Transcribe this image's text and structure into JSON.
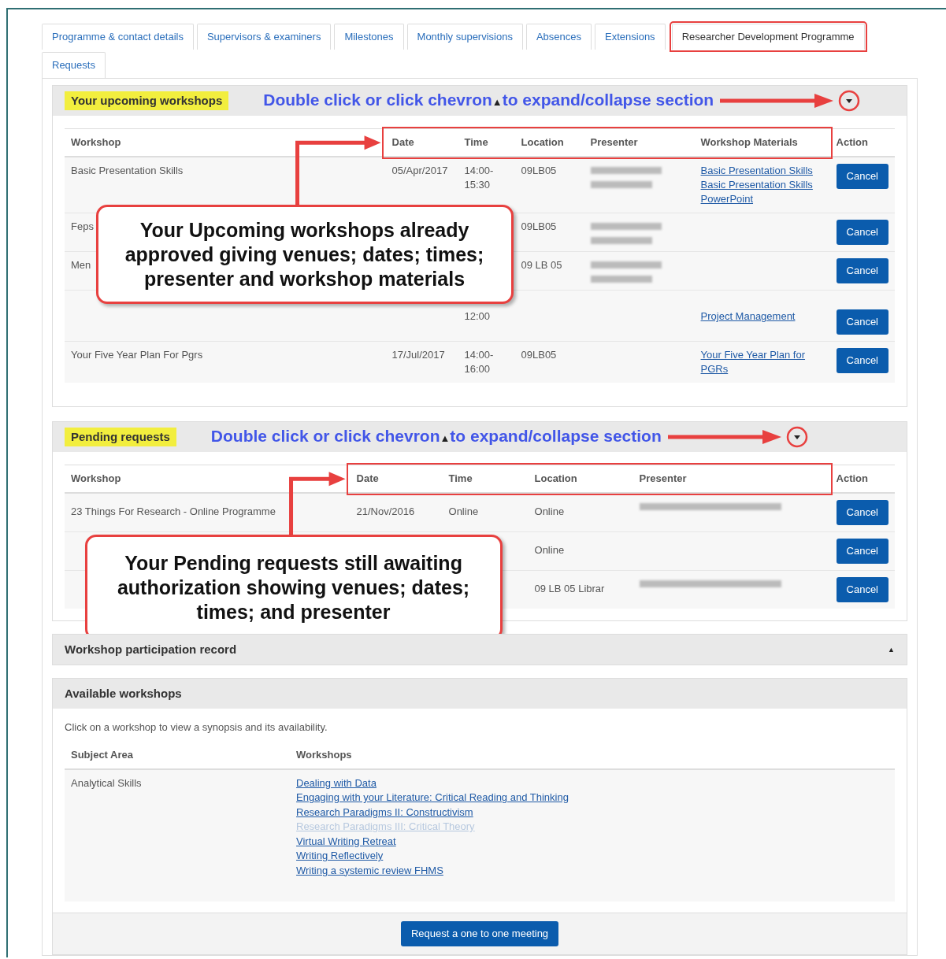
{
  "tabs": [
    {
      "label": "Programme & contact details",
      "selected": false
    },
    {
      "label": "Supervisors & examiners",
      "selected": false
    },
    {
      "label": "Milestones",
      "selected": false
    },
    {
      "label": "Monthly supervisions",
      "selected": false
    },
    {
      "label": "Absences",
      "selected": false
    },
    {
      "label": "Extensions",
      "selected": false
    },
    {
      "label": "Researcher Development Programme",
      "selected": true
    },
    {
      "label": "Requests",
      "selected": false
    }
  ],
  "upcoming": {
    "title": "Your upcoming workshops",
    "expanded": true,
    "instruction": {
      "before": "Double click or click chevron",
      "glyph": "▲",
      "after": "to expand/collapse section"
    },
    "columns": [
      "Workshop",
      "Date",
      "Time",
      "Location",
      "Presenter",
      "Workshop Materials",
      "Action"
    ],
    "rows": [
      {
        "workshop": "Basic Presentation Skills",
        "date": "05/Apr/2017",
        "time": [
          "14:00-",
          "15:30"
        ],
        "location": "09LB05",
        "presenter_redacted": true,
        "materials": [
          "Basic Presentation Skills",
          "Basic Presentation Skills",
          "PowerPoint"
        ],
        "action": "Cancel"
      },
      {
        "workshop": "Feps",
        "time": [],
        "location": "09LB05",
        "presenter_redacted": true,
        "materials": [],
        "action": "Cancel"
      },
      {
        "workshop": "Men",
        "time": [],
        "location": "09 LB 05",
        "presenter_redacted": true,
        "materials": [],
        "action": "Cancel"
      },
      {
        "time": [
          "12:00"
        ],
        "presenter_redacted": false,
        "materials": [
          "Project Management"
        ],
        "action": "Cancel"
      },
      {
        "workshop": "Your Five Year Plan For Pgrs",
        "date": "17/Jul/2017",
        "time": [
          "14:00-",
          "16:00"
        ],
        "location": "09LB05",
        "presenter_redacted": false,
        "materials": [
          "Your Five Year Plan for",
          "PGRs"
        ],
        "action": "Cancel"
      }
    ],
    "callout": "Your Upcoming workshops already approved giving venues; dates; times; presenter and workshop materials"
  },
  "pending": {
    "title": "Pending requests",
    "expanded": true,
    "instruction": {
      "before": "Double click or click chevron",
      "glyph": "▲",
      "after": "to expand/collapse section"
    },
    "columns": [
      "Workshop",
      "Date",
      "Time",
      "Location",
      "Presenter",
      "Action"
    ],
    "rows": [
      {
        "workshop": "23 Things For Research - Online Programme",
        "date": "21/Nov/2016",
        "time": "Online",
        "location": "Online",
        "presenter_redacted": true,
        "action": "Cancel"
      },
      {
        "location": "Online",
        "presenter_redacted": false,
        "action": "Cancel"
      },
      {
        "location": "09 LB 05 Librar",
        "presenter_redacted": true,
        "action": "Cancel"
      }
    ],
    "callout": "Your Pending requests still awaiting authorization showing venues; dates; times; and presenter"
  },
  "participation": {
    "title": "Workshop participation record",
    "expanded": false,
    "toggle": "▲"
  },
  "available": {
    "title": "Available workshops",
    "expanded": true,
    "intro": "Click on a workshop to view a synopsis and its availability.",
    "columns": [
      "Subject Area",
      "Workshops"
    ],
    "rows": [
      {
        "subject": "Analytical Skills",
        "workshops": [
          {
            "label": "Dealing with Data",
            "faded": false
          },
          {
            "label": "Engaging with your Literature: Critical Reading and Thinking",
            "faded": false
          },
          {
            "label": "Research Paradigms II: Constructivism",
            "faded": false
          },
          {
            "label": "Research Paradigms III: Critical Theory",
            "faded": true
          },
          {
            "label": "Virtual Writing Retreat",
            "faded": false
          },
          {
            "label": "Writing Reflectively",
            "faded": false
          },
          {
            "label": "Writing a systemic review FHMS",
            "faded": false
          }
        ]
      }
    ],
    "footer_button": "Request a one to one meeting"
  }
}
